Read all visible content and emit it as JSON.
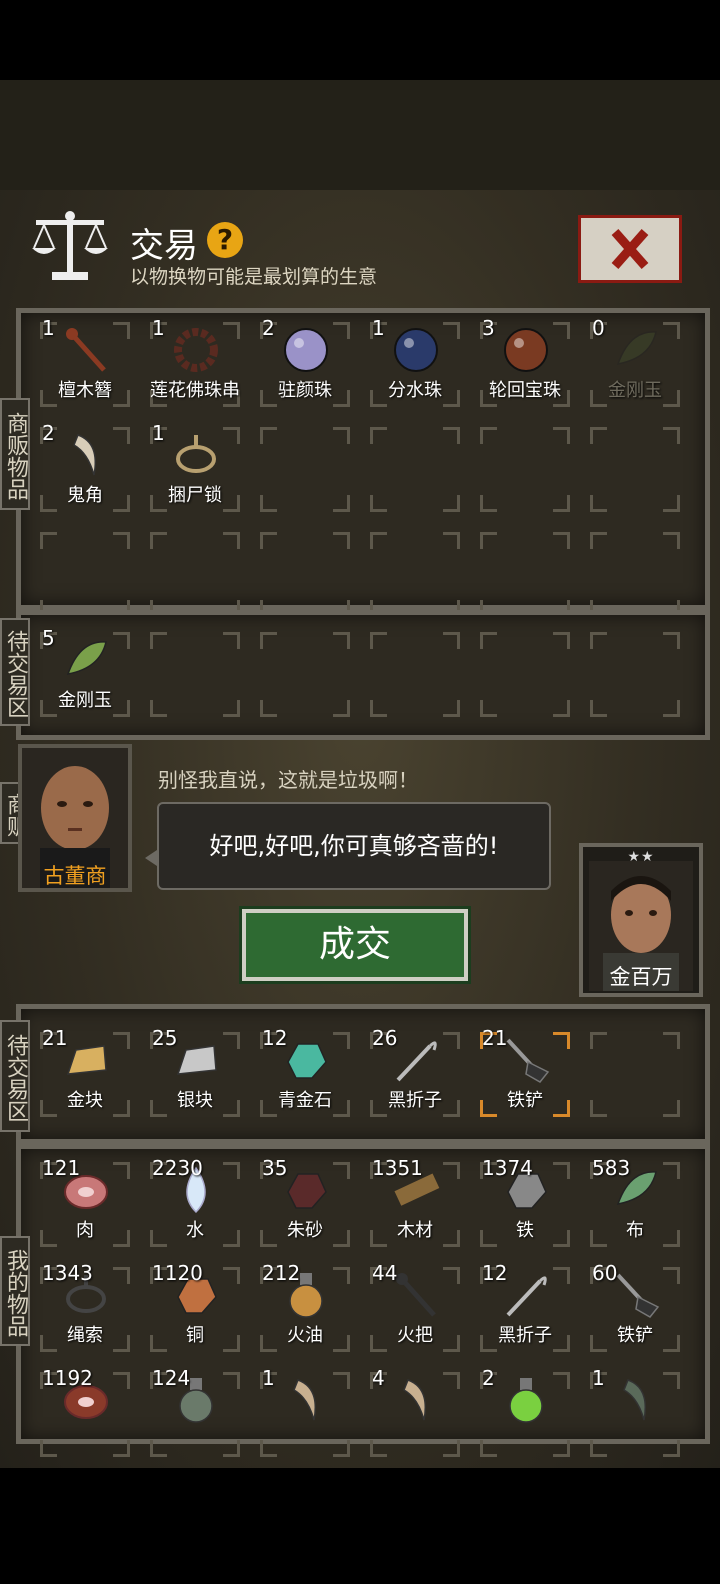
{
  "header": {
    "title": "交易",
    "help_label": "?",
    "subtitle": "以物换物可能是最划算的生意"
  },
  "merchant_tabs": {
    "goods": "商贩物品",
    "merchant_pending": "待交易区",
    "merchant": "商贩",
    "my_pending": "待交易区",
    "my_goods": "我的物品"
  },
  "merchant_goods": [
    {
      "qty": "1",
      "name": "檀木簪",
      "icon": "hairpin-icon",
      "color": "#8b3a22"
    },
    {
      "qty": "1",
      "name": "莲花佛珠串",
      "icon": "prayer-beads-icon",
      "color": "#5a2a20"
    },
    {
      "qty": "2",
      "name": "驻颜珠",
      "icon": "pearl-icon",
      "color": "#9a92c8"
    },
    {
      "qty": "1",
      "name": "分水珠",
      "icon": "water-pearl-icon",
      "color": "#2a3a6a"
    },
    {
      "qty": "3",
      "name": "轮回宝珠",
      "icon": "orb-icon",
      "color": "#7a3a22"
    },
    {
      "qty": "0",
      "name": "金刚玉",
      "icon": "jade-icon",
      "color": "#4a5a30",
      "dim": true
    },
    {
      "qty": "2",
      "name": "鬼角",
      "icon": "horn-icon",
      "color": "#d8cdb8"
    },
    {
      "qty": "1",
      "name": "捆尸锁",
      "icon": "rope-icon",
      "color": "#b8a070"
    }
  ],
  "merchant_pending": [
    {
      "qty": "5",
      "name": "金刚玉",
      "icon": "jade-icon",
      "color": "#7aa04a"
    }
  ],
  "merchant": {
    "comment": "别怪我直说，这就是垃圾啊！",
    "name": "古董商",
    "name_color": "#f0a020"
  },
  "player": {
    "reply": "好吧,好吧,你可真够吝啬的!",
    "name": "金百万",
    "stars": "★★"
  },
  "deal_button": "成交",
  "my_pending": [
    {
      "qty": "21",
      "name": "金块",
      "icon": "gold-bar-icon",
      "color": "#d8b060"
    },
    {
      "qty": "25",
      "name": "银块",
      "icon": "silver-bar-icon",
      "color": "#c8c8c8"
    },
    {
      "qty": "12",
      "name": "青金石",
      "icon": "gem-icon",
      "color": "#4ab8a0"
    },
    {
      "qty": "26",
      "name": "黑折子",
      "icon": "hook-icon",
      "color": "#222"
    },
    {
      "qty": "21",
      "name": "铁铲",
      "icon": "shovel-icon",
      "color": "#333",
      "selected": true
    }
  ],
  "my_goods": [
    {
      "qty": "121",
      "name": "肉",
      "icon": "meat-icon",
      "color": "#c87878"
    },
    {
      "qty": "2230",
      "name": "水",
      "icon": "water-drop-icon",
      "color": "#d8e8f8"
    },
    {
      "qty": "35",
      "name": "朱砂",
      "icon": "cinnabar-icon",
      "color": "#5a2a2a"
    },
    {
      "qty": "1351",
      "name": "木材",
      "icon": "wood-icon",
      "color": "#8a6a3a"
    },
    {
      "qty": "1374",
      "name": "铁",
      "icon": "iron-icon",
      "color": "#888"
    },
    {
      "qty": "583",
      "name": "布",
      "icon": "cloth-icon",
      "color": "#6aa070"
    },
    {
      "qty": "1343",
      "name": "绳索",
      "icon": "rope-coil-icon",
      "color": "#444"
    },
    {
      "qty": "1120",
      "name": "铜",
      "icon": "copper-icon",
      "color": "#c07040"
    },
    {
      "qty": "212",
      "name": "火油",
      "icon": "oil-bottle-icon",
      "color": "#c89040"
    },
    {
      "qty": "44",
      "name": "火把",
      "icon": "torch-icon",
      "color": "#333"
    },
    {
      "qty": "12",
      "name": "黑折子",
      "icon": "hook-icon",
      "color": "#222"
    },
    {
      "qty": "60",
      "name": "铁铲",
      "icon": "shovel-icon",
      "color": "#333"
    },
    {
      "qty": "1192",
      "name": "",
      "icon": "jerky-icon",
      "color": "#8a3a2a"
    },
    {
      "qty": "124",
      "name": "",
      "icon": "flask-icon",
      "color": "#6a7a6a"
    },
    {
      "qty": "1",
      "name": "",
      "icon": "tooth-icon",
      "color": "#c8b090"
    },
    {
      "qty": "4",
      "name": "",
      "icon": "claw-icon",
      "color": "#c8b090"
    },
    {
      "qty": "2",
      "name": "",
      "icon": "potion-icon",
      "color": "#7ad040"
    },
    {
      "qty": "1",
      "name": "",
      "icon": "blade-icon",
      "color": "#5a6a5a"
    }
  ]
}
